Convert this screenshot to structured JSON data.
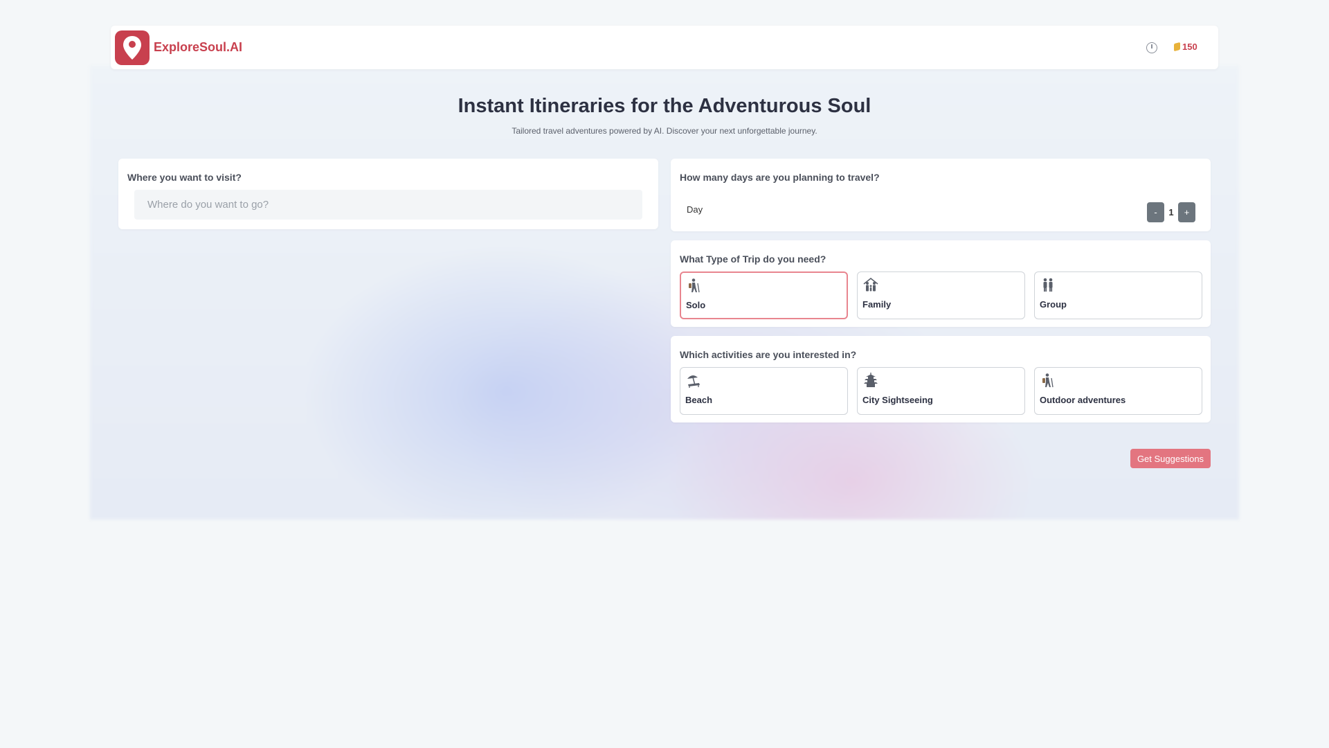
{
  "brand": {
    "name": "ExploreSoul.AI",
    "accent": "#c8404e"
  },
  "header": {
    "history_icon": "history-clock-icon",
    "coin_icon": "coin-stack-icon",
    "coins": "150"
  },
  "hero": {
    "title": "Instant Itineraries for the Adventurous Soul",
    "subtitle": "Tailored travel adventures powered by AI. Discover your next unforgettable journey."
  },
  "destination": {
    "label": "Where you want to visit?",
    "placeholder": "Where do you want to go?",
    "value": ""
  },
  "days": {
    "label": "How many days are you planning to travel?",
    "unit_label": "Day",
    "value": "1",
    "minus": "-",
    "plus": "+"
  },
  "trip_type": {
    "label": "What Type of Trip do you need?",
    "selected": "Solo",
    "options": [
      {
        "label": "Solo",
        "icon": "hiker-icon"
      },
      {
        "label": "Family",
        "icon": "family-icon"
      },
      {
        "label": "Group",
        "icon": "group-icon"
      }
    ]
  },
  "activities": {
    "label": "Which activities are you interested in?",
    "options": [
      {
        "label": "Beach",
        "icon": "beach-umbrella-icon"
      },
      {
        "label": "City Sightseeing",
        "icon": "pagoda-icon"
      },
      {
        "label": "Outdoor adventures",
        "icon": "hiker-icon"
      }
    ]
  },
  "actions": {
    "submit": "Get Suggestions"
  }
}
